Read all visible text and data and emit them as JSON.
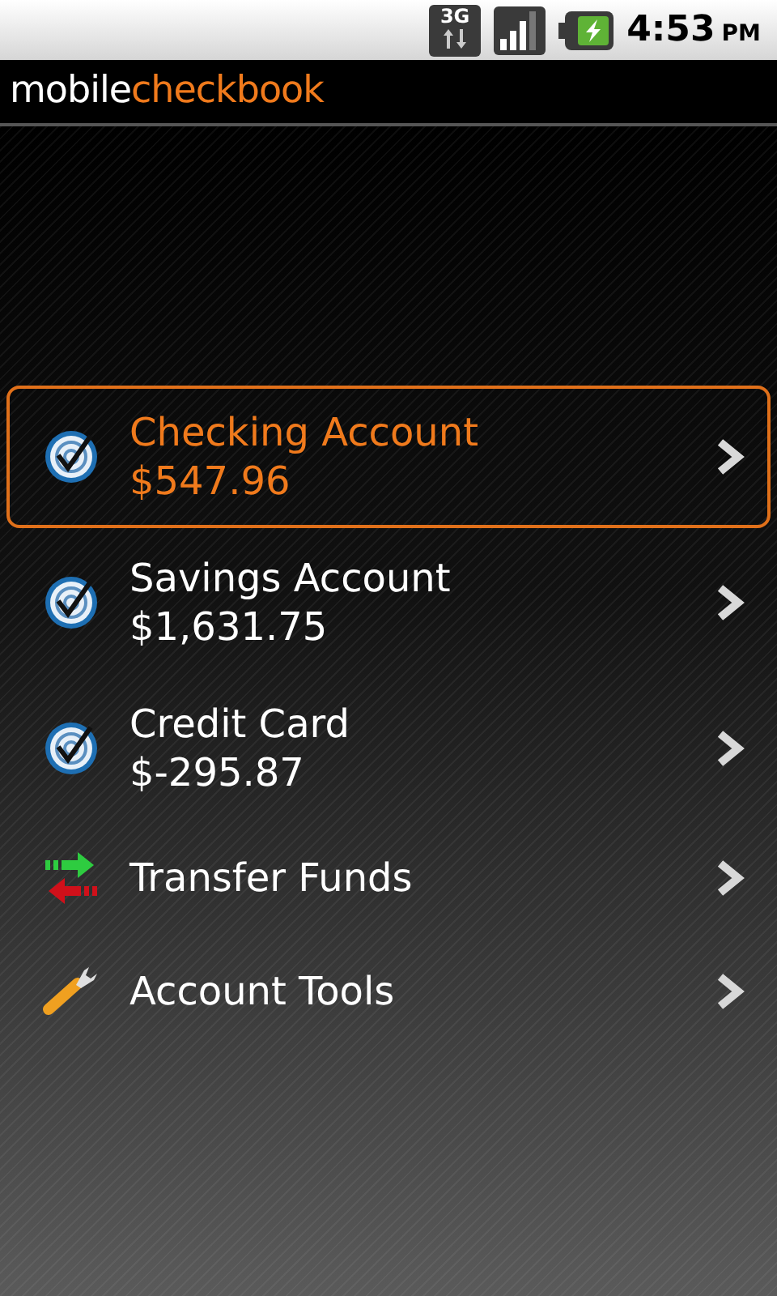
{
  "status_bar": {
    "network": "3G",
    "time": "4:53",
    "meridiem": "PM"
  },
  "app_bar": {
    "brand_prefix": "mobile",
    "brand_suffix": "checkbook"
  },
  "menu": [
    {
      "kind": "account",
      "name": "Checking Account",
      "balance": "$547.96",
      "selected": true
    },
    {
      "kind": "account",
      "name": "Savings Account",
      "balance": "$1,631.75",
      "selected": false
    },
    {
      "kind": "account",
      "name": "Credit Card",
      "balance": "$-295.87",
      "selected": false
    },
    {
      "kind": "transfer",
      "name": "Transfer Funds",
      "selected": false
    },
    {
      "kind": "tools",
      "name": "Account Tools",
      "selected": false
    }
  ]
}
